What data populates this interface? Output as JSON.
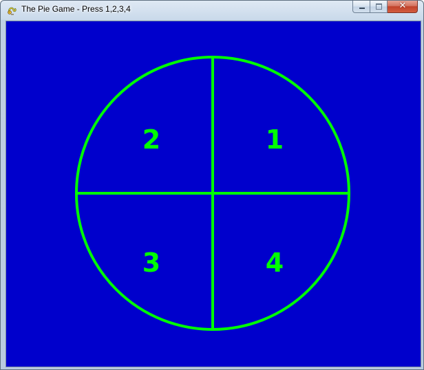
{
  "window": {
    "title": "The Pie Game - Press 1,2,3,4",
    "icon": "pygame-snake-icon",
    "close_glyph": "✕"
  },
  "game": {
    "background_color": "#0000cc",
    "pie_color": "#00ff00",
    "quadrants": [
      {
        "label": "1",
        "position": "top-right"
      },
      {
        "label": "2",
        "position": "top-left"
      },
      {
        "label": "3",
        "position": "bottom-left"
      },
      {
        "label": "4",
        "position": "bottom-right"
      }
    ]
  }
}
